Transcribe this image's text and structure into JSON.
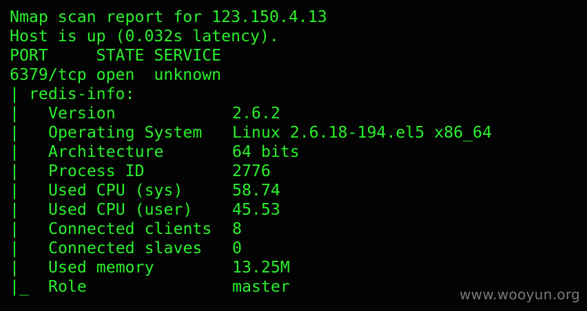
{
  "terminal": {
    "header_lines": [
      "Nmap scan report for 123.150.4.13",
      "Host is up (0.032s latency).",
      "PORT     STATE SERVICE",
      "6379/tcp open  unknown",
      "| redis-info:"
    ],
    "info_prefix": "|",
    "last_prefix": "|_",
    "rows": [
      {
        "key": "Version",
        "value": "2.6.2"
      },
      {
        "key": "Operating System",
        "value": "Linux 2.6.18-194.el5 x86_64"
      },
      {
        "key": "Architecture",
        "value": "64 bits"
      },
      {
        "key": "Process ID",
        "value": "2776"
      },
      {
        "key": "Used CPU (sys)",
        "value": "58.74"
      },
      {
        "key": "Used CPU (user)",
        "value": "45.53"
      },
      {
        "key": "Connected clients",
        "value": "8"
      },
      {
        "key": "Connected slaves",
        "value": "0"
      },
      {
        "key": "Used memory",
        "value": "13.25M"
      },
      {
        "key": "Role",
        "value": "master"
      }
    ]
  },
  "watermark": "www.wooyun.org",
  "colors": {
    "text": "#2cef2e",
    "background": "#020302",
    "watermark": "#7a7a7a"
  }
}
